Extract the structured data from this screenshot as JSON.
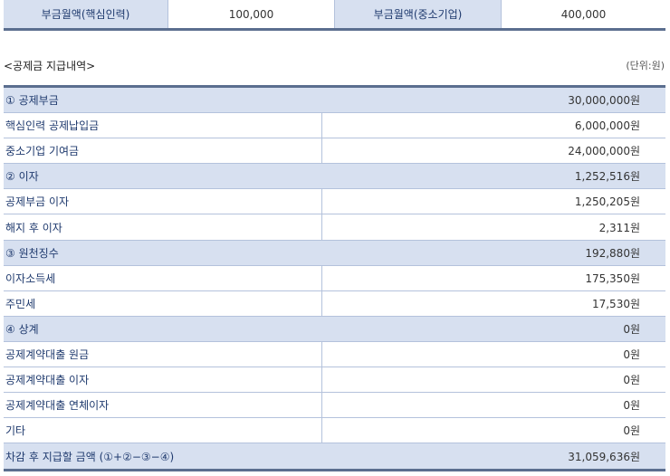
{
  "top": {
    "label1": "부금월액(핵심인력)",
    "value1": "100,000",
    "label2": "부금월액(중소기업)",
    "value2": "400,000"
  },
  "section": {
    "title": "<공제금 지급내역>",
    "unit": "(단위:원)"
  },
  "rows": [
    {
      "label": "① 공제부금",
      "value": "30,000,000원"
    },
    {
      "label": "핵심인력 공제납입금",
      "value": "6,000,000원"
    },
    {
      "label": "중소기업 기여금",
      "value": "24,000,000원"
    },
    {
      "label": "② 이자",
      "value": "1,252,516원"
    },
    {
      "label": "공제부금 이자",
      "value": "1,250,205원"
    },
    {
      "label": "해지 후 이자",
      "value": "2,311원"
    },
    {
      "label": "③ 원천징수",
      "value": "192,880원"
    },
    {
      "label": "이자소득세",
      "value": "175,350원"
    },
    {
      "label": "주민세",
      "value": "17,530원"
    },
    {
      "label": "④ 상계",
      "value": "0원"
    },
    {
      "label": "공제계약대출 원금",
      "value": "0원"
    },
    {
      "label": "공제계약대출 이자",
      "value": "0원"
    },
    {
      "label": "공제계약대출 연체이자",
      "value": "0원"
    },
    {
      "label": "기타",
      "value": "0원"
    },
    {
      "label": "차감 후 지급할 금액 (①+②−③−④)",
      "value": "31,059,636원"
    }
  ]
}
